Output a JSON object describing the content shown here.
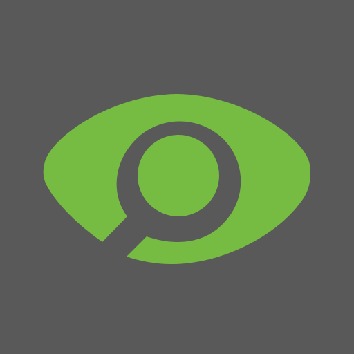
{
  "icon": {
    "name": "eye-magnifier-icon",
    "colors": {
      "background": "#595959",
      "eye": "#76BC43",
      "cutout": "#595959"
    }
  }
}
